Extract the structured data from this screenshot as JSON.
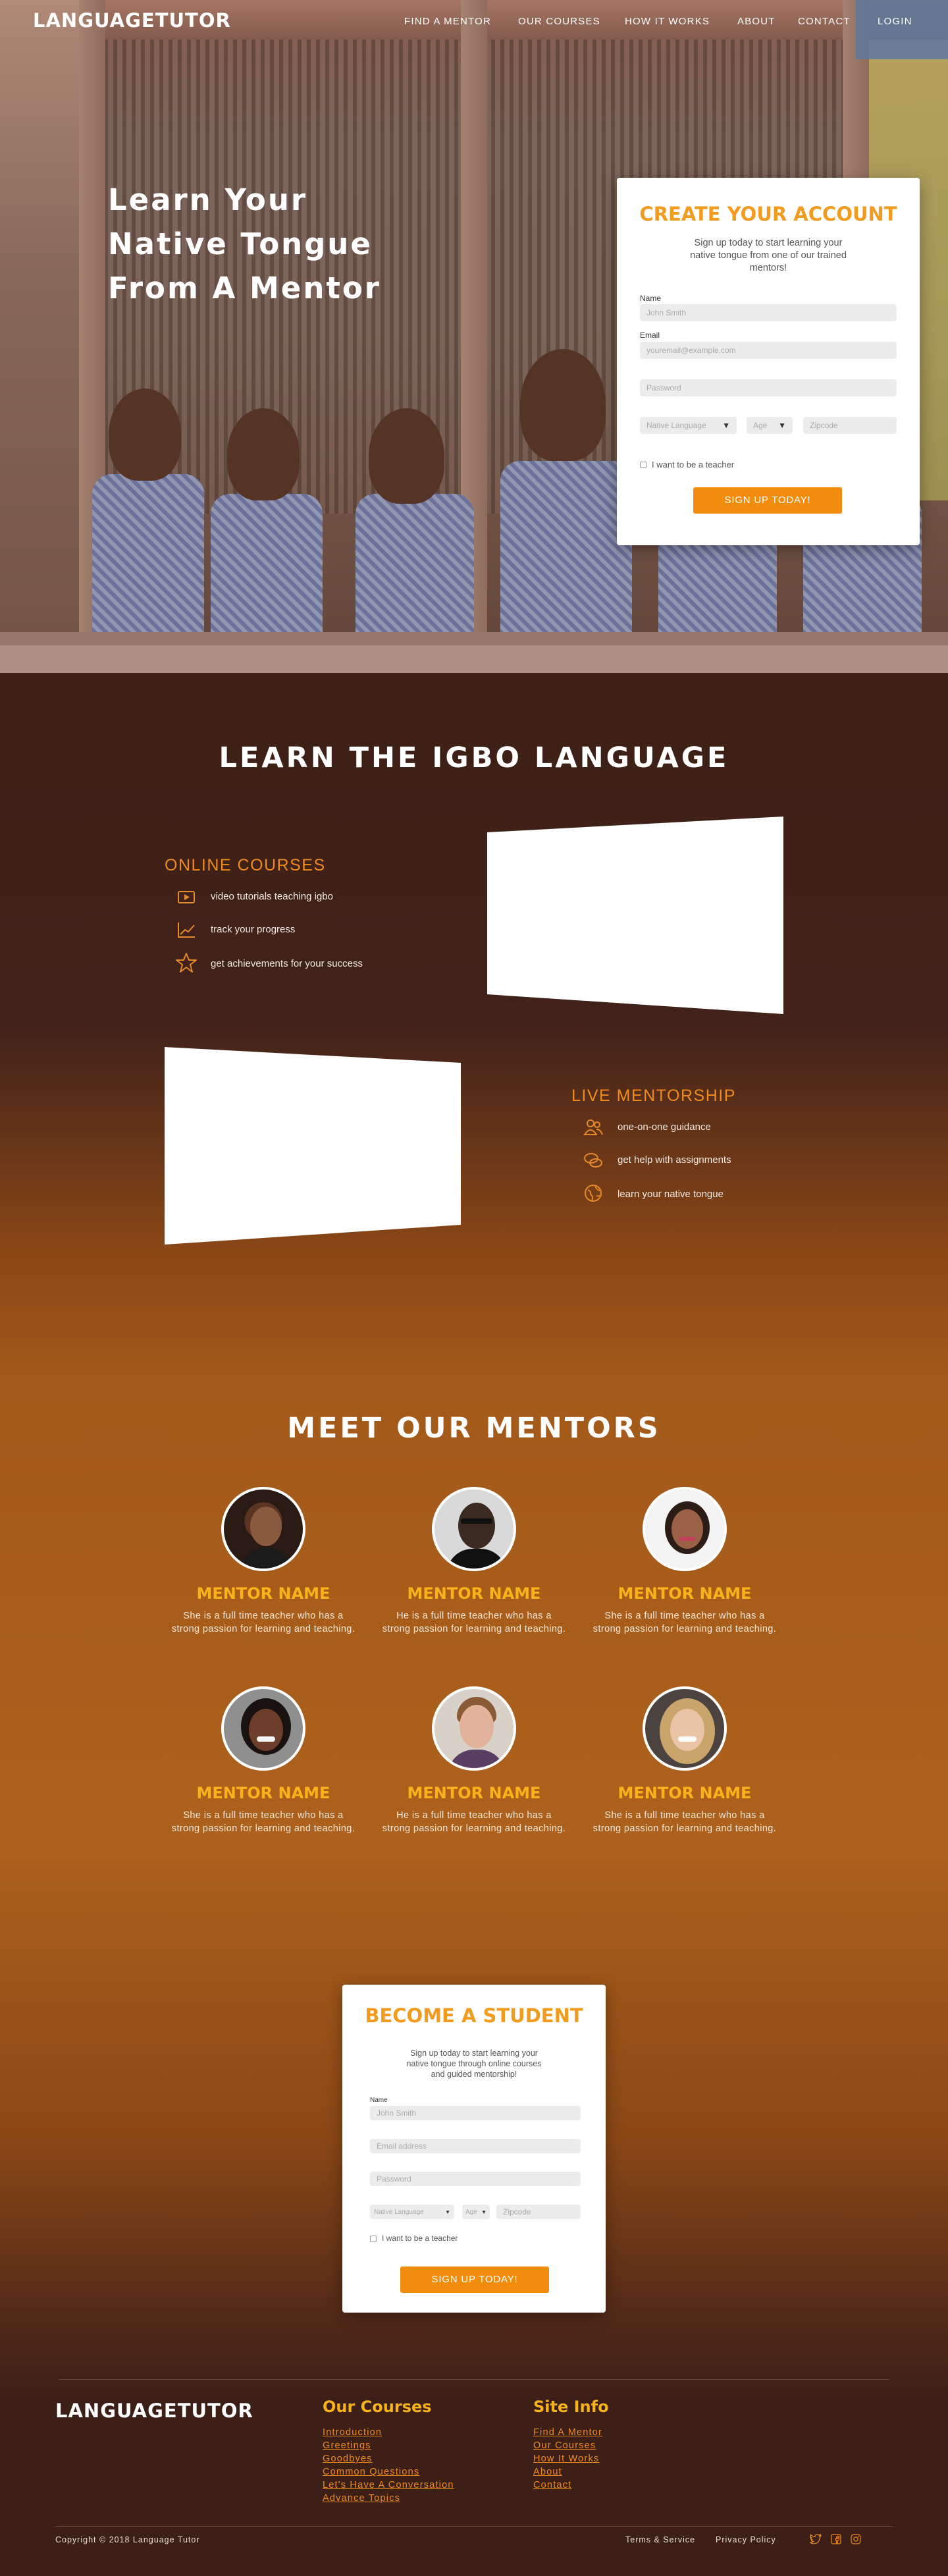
{
  "header": {
    "logo": "LANGUAGETUTOR",
    "nav": [
      "FIND A MENTOR",
      "OUR COURSES",
      "HOW IT WORKS",
      "ABOUT",
      "CONTACT",
      "LOGIN"
    ]
  },
  "hero": {
    "title_lines": [
      "Learn Your",
      "Native Tongue",
      "From A Mentor"
    ]
  },
  "signup": {
    "title": "CREATE YOUR ACCOUNT",
    "subtitle_lines": [
      "Sign up today to start learning your",
      "native tongue from one of our trained",
      "mentors!"
    ],
    "name_label": "Name",
    "name_placeholder": "John Smith",
    "email_label": "Email",
    "email_placeholder": "youremail@example.com",
    "password_placeholder": "Password",
    "native_language": "Native Language",
    "age": "Age",
    "zipcode": "Zipcode",
    "teacher_label": "I want to be a teacher",
    "button": "SIGN UP TODAY!"
  },
  "igbo": {
    "title": "LEARN THE IGBO LANGUAGE",
    "online": {
      "title": "ONLINE COURSES",
      "items": [
        "video tutorials teaching igbo",
        "track your progress",
        "get achievements for your success"
      ],
      "icons": [
        "play-icon",
        "chart-icon",
        "star-icon"
      ]
    },
    "live": {
      "title": "LIVE MENTORSHIP",
      "items": [
        "one-on-one guidance",
        "get help with assignments",
        "learn your native tongue"
      ],
      "icons": [
        "people-icon",
        "chat-icon",
        "globe-icon"
      ]
    }
  },
  "mentors": {
    "title": "MEET OUR MENTORS",
    "list": [
      {
        "name": "MENTOR NAME",
        "bio": "She is a full time teacher who has a strong passion for learning and teaching."
      },
      {
        "name": "MENTOR NAME",
        "bio": "He is a full time teacher who has a strong passion for learning and teaching."
      },
      {
        "name": "MENTOR NAME",
        "bio": "She is a full time teacher who has a strong passion for learning and teaching."
      },
      {
        "name": "MENTOR NAME",
        "bio": "She is a full time teacher who has a strong passion for learning and teaching."
      },
      {
        "name": "MENTOR NAME",
        "bio": "He is a full time teacher who has a strong passion for learning and teaching."
      },
      {
        "name": "MENTOR NAME",
        "bio": "She is a full time teacher who has a strong passion for learning and teaching."
      }
    ]
  },
  "student": {
    "title": "BECOME A STUDENT",
    "subtitle_lines": [
      "Sign up today to start learning your",
      "native tongue through online courses",
      "and guided mentorship!"
    ],
    "name_label": "Name",
    "name_placeholder": "John Smith",
    "email_placeholder": "Email address",
    "password_placeholder": "Password",
    "native_language": "Native Language",
    "age": "Age",
    "zipcode": "Zipcode",
    "teacher_label": "I want to be a teacher",
    "button": "SIGN UP TODAY!"
  },
  "footer": {
    "logo": "LANGUAGETUTOR",
    "courses_title": "Our Courses",
    "courses": [
      "Introduction",
      "Greetings",
      "Goodbyes",
      "Common Questions",
      "Let's Have A Conversation",
      "Advance Topics"
    ],
    "info_title": "Site Info",
    "info": [
      "Find A Mentor",
      "Our Courses",
      "How It Works",
      "About",
      "Contact"
    ],
    "copyright": "Copyright © 2018 Language Tutor",
    "terms": "Terms & Service",
    "privacy": "Privacy Policy",
    "social": [
      "twitter-icon",
      "facebook-icon",
      "instagram-icon"
    ]
  },
  "colors": {
    "accent": "#f29c1f",
    "cta": "#f28c0c",
    "mentor_name": "#f8b21b",
    "dark_brown": "#3d2016",
    "orange_brown": "#ad611c"
  }
}
